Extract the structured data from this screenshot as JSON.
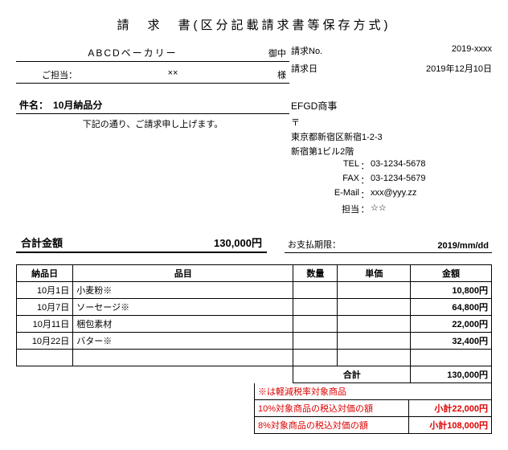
{
  "title": "請　求　書(区分記載請求書等保存方式)",
  "client": {
    "name": "ABCDベーカリー",
    "name_suffix": "御中",
    "contact_label": "ご担当：",
    "contact_name": "××",
    "contact_suffix": "様"
  },
  "meta": {
    "number_label": "請求No.",
    "number_value": "2019-xxxx",
    "date_label": "請求日",
    "date_value": "2019年12月10日"
  },
  "subject": {
    "label": "件名：",
    "value": "10月納品分"
  },
  "note": "下記の通り、ご請求申し上げます。",
  "issuer": {
    "company": "EFGD商事",
    "postal_mark": "〒",
    "address1": "東京都新宿区新宿1-2-3",
    "address2": "新宿第1ビル2階",
    "tel_label": "TEL",
    "tel": "03-1234-5678",
    "fax_label": "FAX",
    "fax": "03-1234-5679",
    "email_label": "E-Mail",
    "email": "xxx@yyy.zz",
    "person_label": "担当",
    "person": "☆☆"
  },
  "summary": {
    "total_label": "合計金額",
    "total_value": "130,000円",
    "due_label": "お支払期限：",
    "due_value": "2019/mm/dd"
  },
  "table": {
    "headers": {
      "date": "納品日",
      "item": "品目",
      "qty": "数量",
      "price": "単価",
      "amount": "金額"
    },
    "rows": [
      {
        "date": "10月1日",
        "item": "小麦粉※",
        "qty": "",
        "price": "",
        "amount": "10,800円"
      },
      {
        "date": "10月7日",
        "item": "ソーセージ※",
        "qty": "",
        "price": "",
        "amount": "64,800円"
      },
      {
        "date": "10月11日",
        "item": "梱包素材",
        "qty": "",
        "price": "",
        "amount": "22,000円"
      },
      {
        "date": "10月22日",
        "item": "バター※",
        "qty": "",
        "price": "",
        "amount": "32,400円"
      },
      {
        "date": "",
        "item": "",
        "qty": "",
        "price": "",
        "amount": ""
      }
    ],
    "sum_label": "合計",
    "sum_value": "130,000円"
  },
  "tax_notes": {
    "note1": "※は軽減税率対象商品",
    "row1_label": "10%対象商品の税込対価の額",
    "row1_value": "小計22,000円",
    "row2_label": "8%対象商品の税込対価の額",
    "row2_value": "小計108,000円"
  }
}
